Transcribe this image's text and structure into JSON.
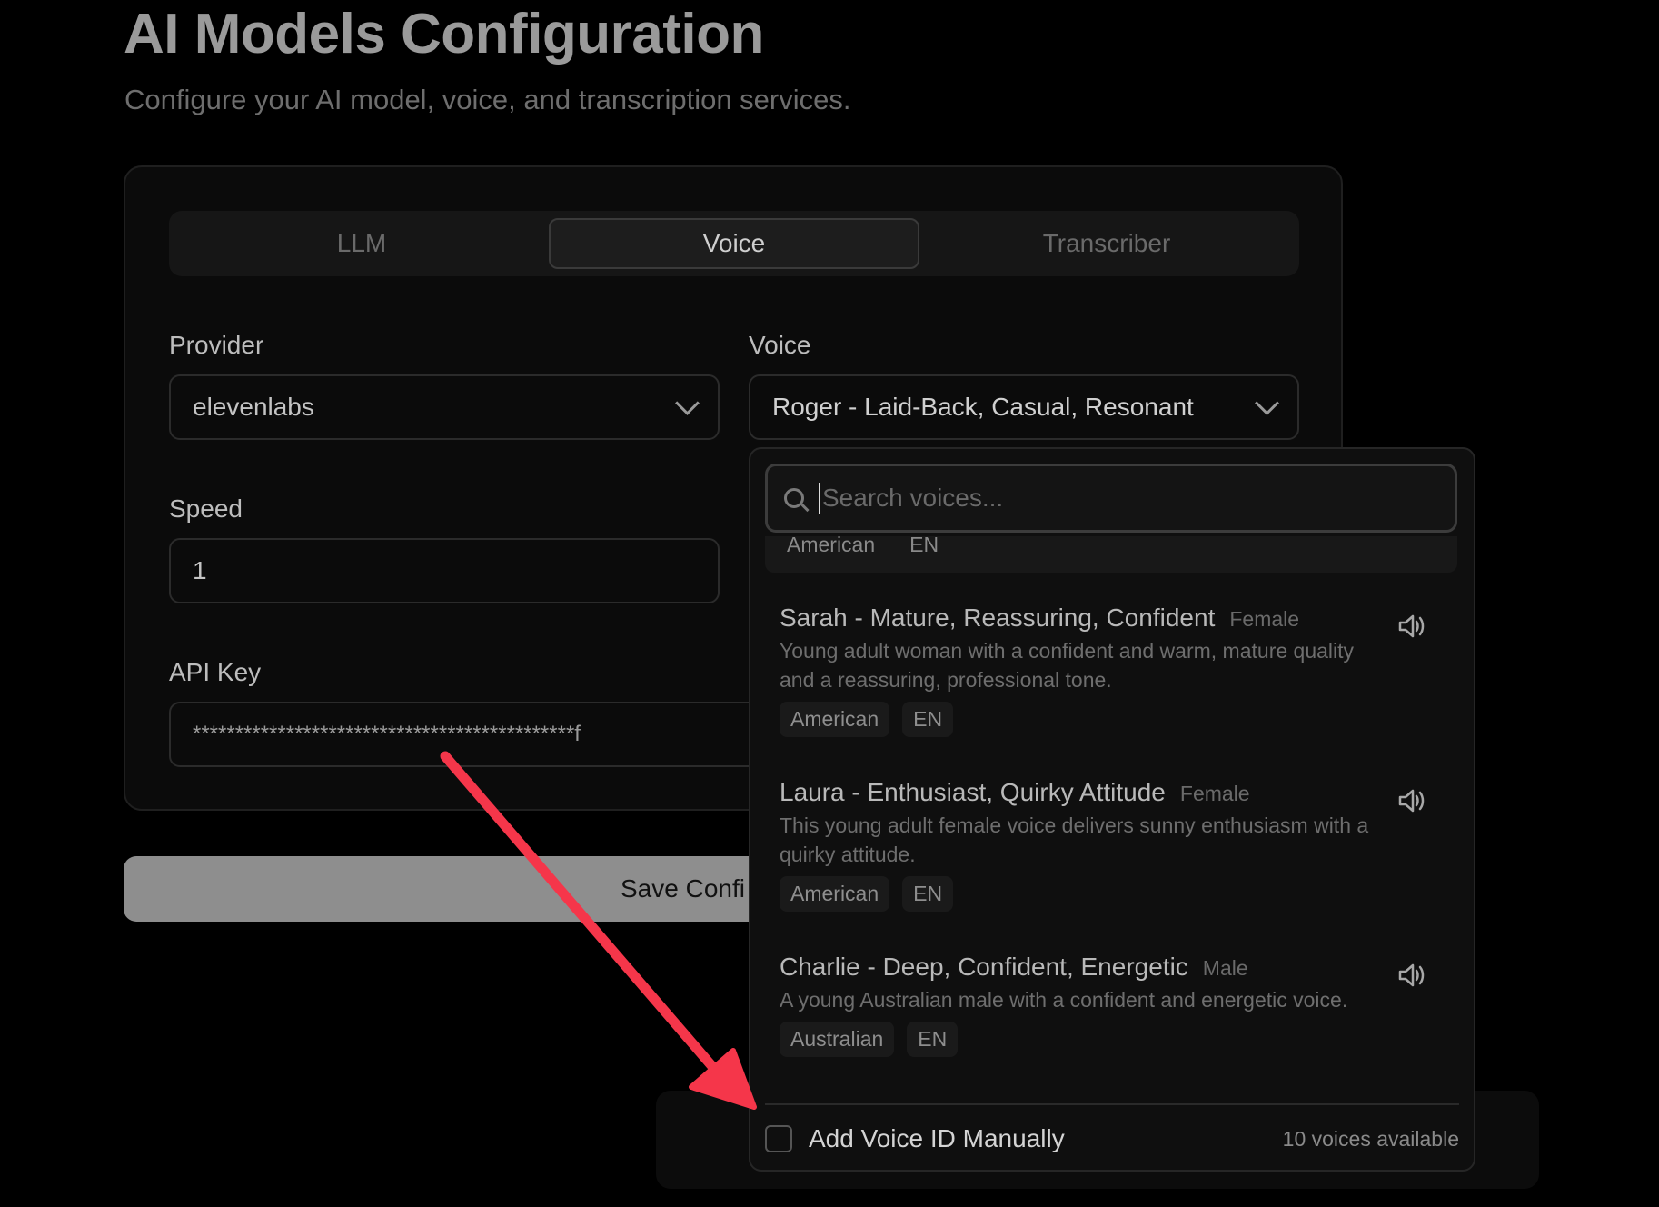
{
  "page": {
    "title": "AI Models Configuration",
    "subtitle": "Configure your AI model, voice, and transcription services."
  },
  "tabs": [
    "LLM",
    "Voice",
    "Transcriber"
  ],
  "form": {
    "provider_label": "Provider",
    "provider_value": "elevenlabs",
    "voice_label": "Voice",
    "voice_value": "Roger - Laid-Back, Casual, Resonant",
    "speed_label": "Speed",
    "speed_value": "1",
    "api_key_label": "API Key",
    "api_key_value": "*********************************************f"
  },
  "save_button": "Save Confi",
  "dropdown": {
    "search_placeholder": "Search voices...",
    "previous_tags": [
      "American",
      "EN"
    ],
    "voices": [
      {
        "name": "Sarah - Mature, Reassuring, Confident",
        "gender": "Female",
        "description": "Young adult woman with a confident and warm, mature quality and a reassuring, professional tone.",
        "tags": [
          "American",
          "EN"
        ]
      },
      {
        "name": "Laura - Enthusiast, Quirky Attitude",
        "gender": "Female",
        "description": "This young adult female voice delivers sunny enthusiasm with a quirky attitude.",
        "tags": [
          "American",
          "EN"
        ]
      },
      {
        "name": "Charlie - Deep, Confident, Energetic",
        "gender": "Male",
        "description": "A young Australian male with a confident and energetic voice.",
        "tags": [
          "Australian",
          "EN"
        ]
      }
    ],
    "manual_label": "Add Voice ID Manually",
    "count": "10 voices available"
  },
  "colors": {
    "background": "#000000",
    "annotation_arrow": "#f5364a"
  },
  "icons": [
    "search-icon",
    "chevron-down-icon",
    "speaker-icon",
    "annotation-arrow"
  ]
}
